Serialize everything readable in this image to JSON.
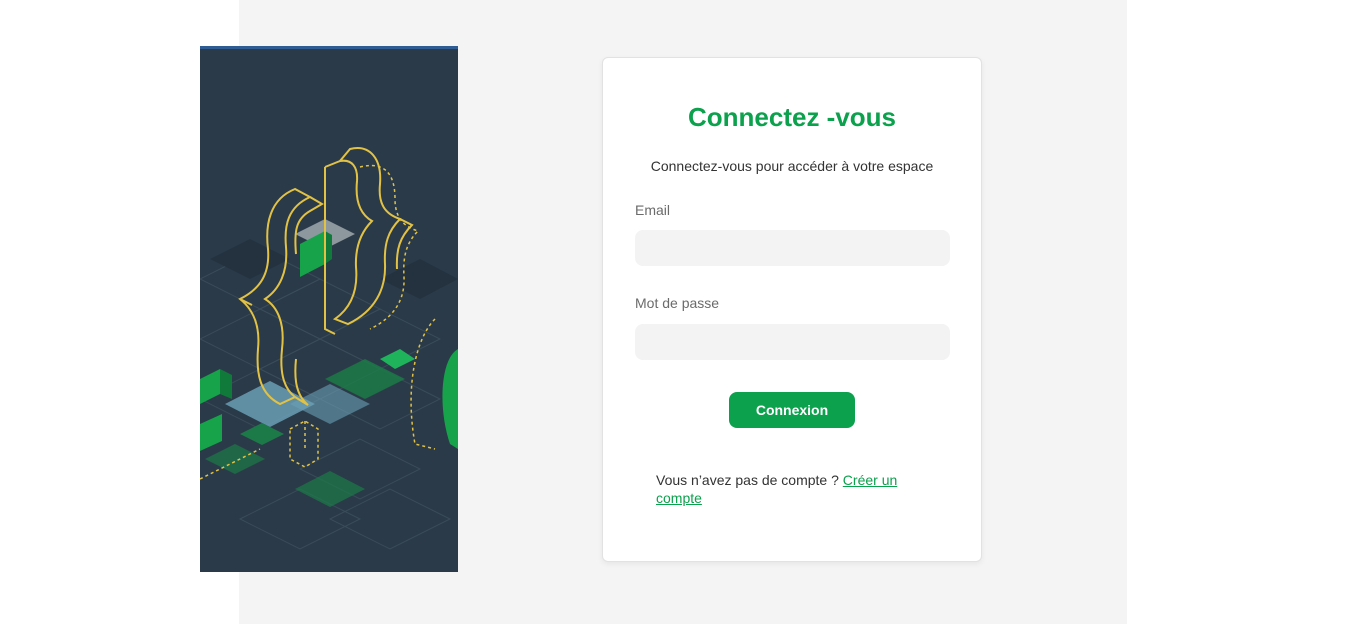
{
  "login": {
    "title": "Connectez -vous",
    "subtitle": "Connectez-vous pour accéder à votre espace",
    "email_label": "Email",
    "email_value": "",
    "password_label": "Mot de passe",
    "password_value": "",
    "submit_label": "Connexion",
    "signup_prompt": "Vous n’avez pas de compte ?",
    "signup_link": "Créer un compte"
  },
  "colors": {
    "accent": "#0ca14d",
    "hero_bg": "#2a3a48",
    "page_bg": "#f4f4f4",
    "input_bg": "#f3f3f3"
  },
  "hero": {
    "icon": "code-braces-illustration"
  }
}
